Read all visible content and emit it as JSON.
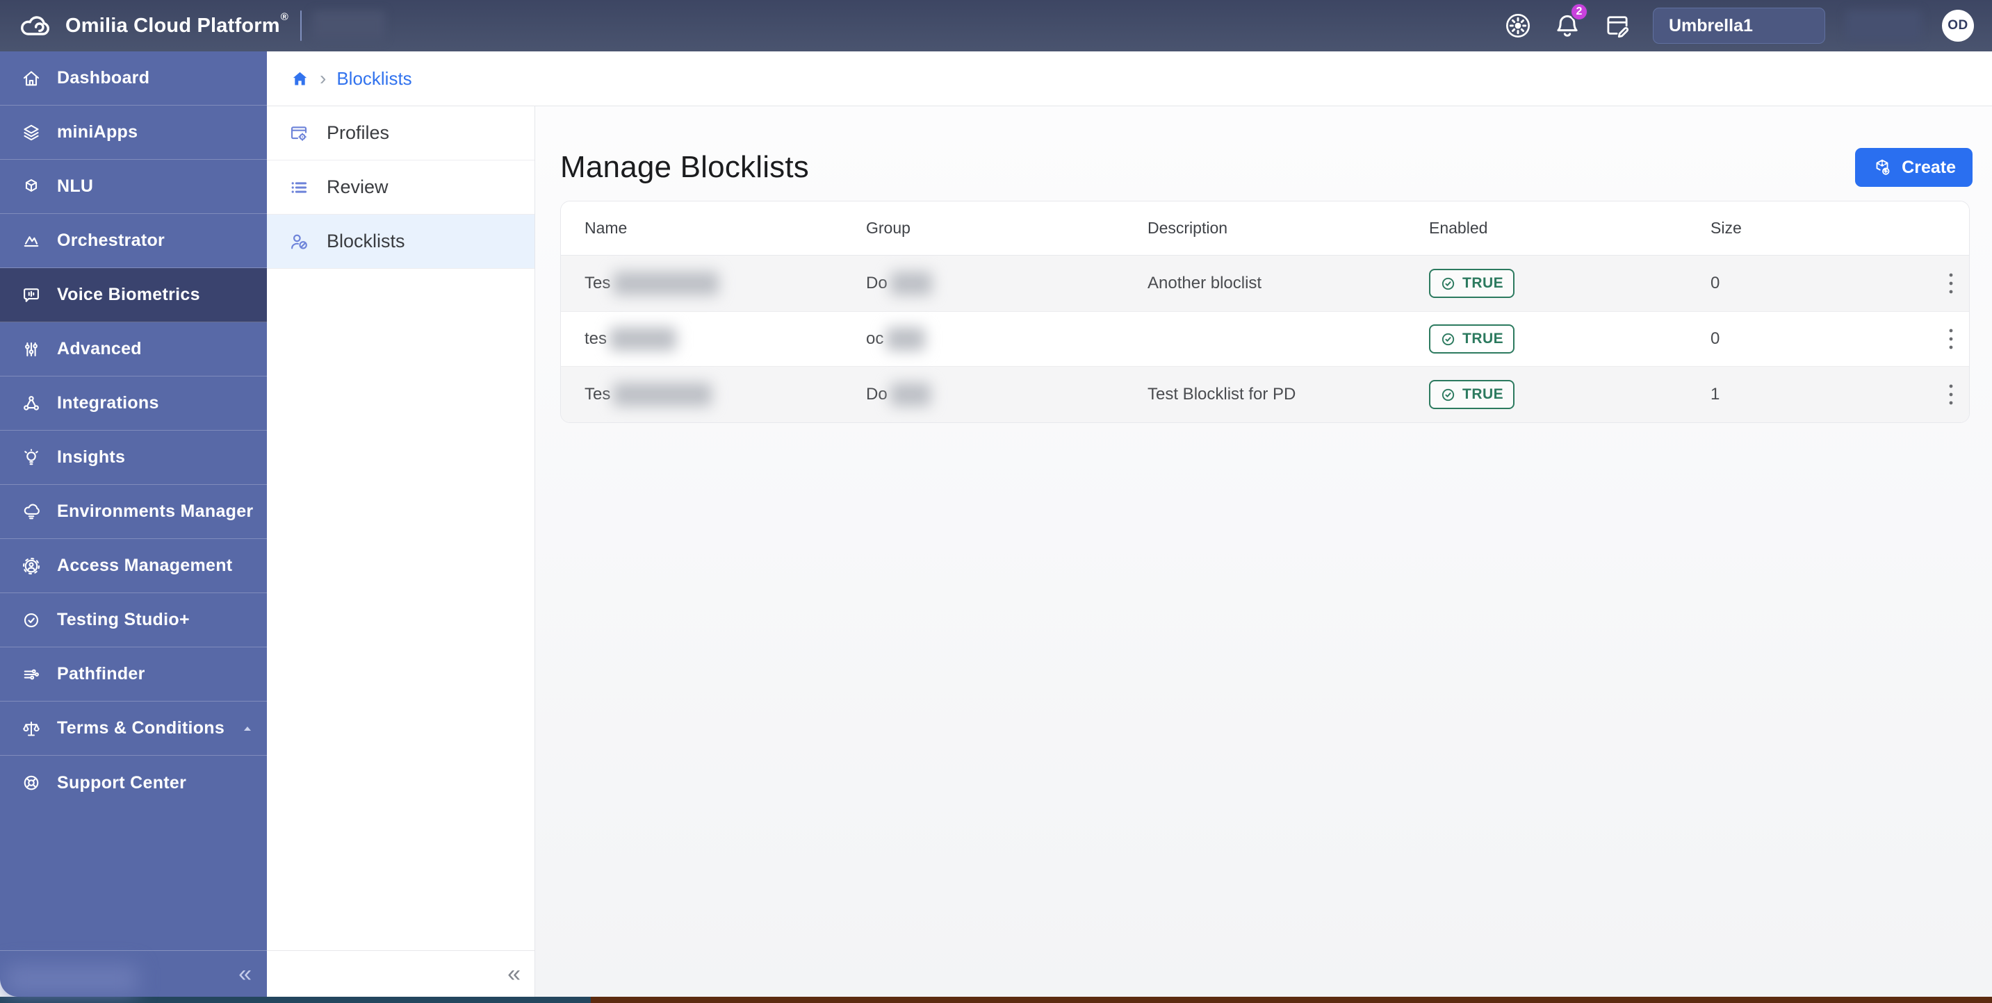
{
  "topbar": {
    "logo_text": "Omilia Cloud Platform",
    "logo_reg": "®",
    "notification_count": "2",
    "org_selector_value": "Umbrella1",
    "avatar_initials": "OD",
    "icons": [
      "theme-settings-icon",
      "notifications-bell-icon",
      "release-notes-icon"
    ],
    "redactions": {
      "after_logo": true,
      "before_avatar": true
    }
  },
  "sidebar": {
    "items": [
      {
        "label": "Dashboard",
        "icon": "home-icon",
        "selected": false
      },
      {
        "label": "miniApps",
        "icon": "layers-icon",
        "selected": false
      },
      {
        "label": "NLU",
        "icon": "cube-icon",
        "selected": false
      },
      {
        "label": "Orchestrator",
        "icon": "activity-icon",
        "selected": false
      },
      {
        "label": "Voice Biometrics",
        "icon": "voice-bubble-icon",
        "selected": true
      },
      {
        "label": "Advanced",
        "icon": "sliders-icon",
        "selected": false
      },
      {
        "label": "Integrations",
        "icon": "nodes-icon",
        "selected": false
      },
      {
        "label": "Insights",
        "icon": "lightbulb-icon",
        "selected": false
      },
      {
        "label": "Environments Manager",
        "icon": "cloud-icon",
        "selected": false
      },
      {
        "label": "Access Management",
        "icon": "gear-user-icon",
        "selected": false
      },
      {
        "label": "Testing Studio+",
        "icon": "badge-check-icon",
        "selected": false
      },
      {
        "label": "Pathfinder",
        "icon": "circuit-icon",
        "selected": false
      },
      {
        "label": "Terms & Conditions",
        "icon": "scale-icon",
        "selected": false,
        "expanded": true
      },
      {
        "label": "Support Center",
        "icon": "lifebuoy-icon",
        "selected": false
      }
    ],
    "collapse_glyph": "«",
    "footer_redacted": true
  },
  "breadcrumb": {
    "home_icon": "home-icon",
    "separator": "›",
    "current": "Blocklists"
  },
  "subnav": {
    "items": [
      {
        "label": "Profiles",
        "icon": "window-gear-icon",
        "selected": false
      },
      {
        "label": "Review",
        "icon": "list-icon",
        "selected": false
      },
      {
        "label": "Blocklists",
        "icon": "user-block-icon",
        "selected": true
      }
    ],
    "collapse_glyph": "«"
  },
  "page": {
    "title": "Manage Blocklists",
    "create_label": "Create",
    "create_icon": "cube-plus-icon"
  },
  "table": {
    "columns": [
      "Name",
      "Group",
      "Description",
      "Enabled",
      "Size"
    ],
    "rows": [
      {
        "name_visible": "Tes",
        "name_redacted": true,
        "group_visible": "Do",
        "group_redacted": true,
        "description": "Another bloclist",
        "enabled": "TRUE",
        "size": "0"
      },
      {
        "name_visible": "tes",
        "name_redacted": true,
        "group_visible": "oc",
        "group_redacted": true,
        "description": "",
        "enabled": "TRUE",
        "size": "0"
      },
      {
        "name_visible": "Tes",
        "name_redacted": true,
        "group_visible": "Do",
        "group_redacted": true,
        "description": "Test Blocklist for PD",
        "enabled": "TRUE",
        "size": "1"
      }
    ],
    "enabled_badge_icon": "check-circle-icon",
    "row_menu_icon": "kebab-icon"
  },
  "colors": {
    "topbar": "#424c6c",
    "sidebar": "#5869a7",
    "sidebar_selected": "#3a436e",
    "subnav_selected_bg": "#e9f2fd",
    "subnav_icon": "#6d83d9",
    "link_blue": "#3273ee",
    "create_blue": "#2a6ff0",
    "badge_green": "#2c7a5f",
    "notification_badge": "#c941dd",
    "row_stripe": "#f5f5f6"
  }
}
